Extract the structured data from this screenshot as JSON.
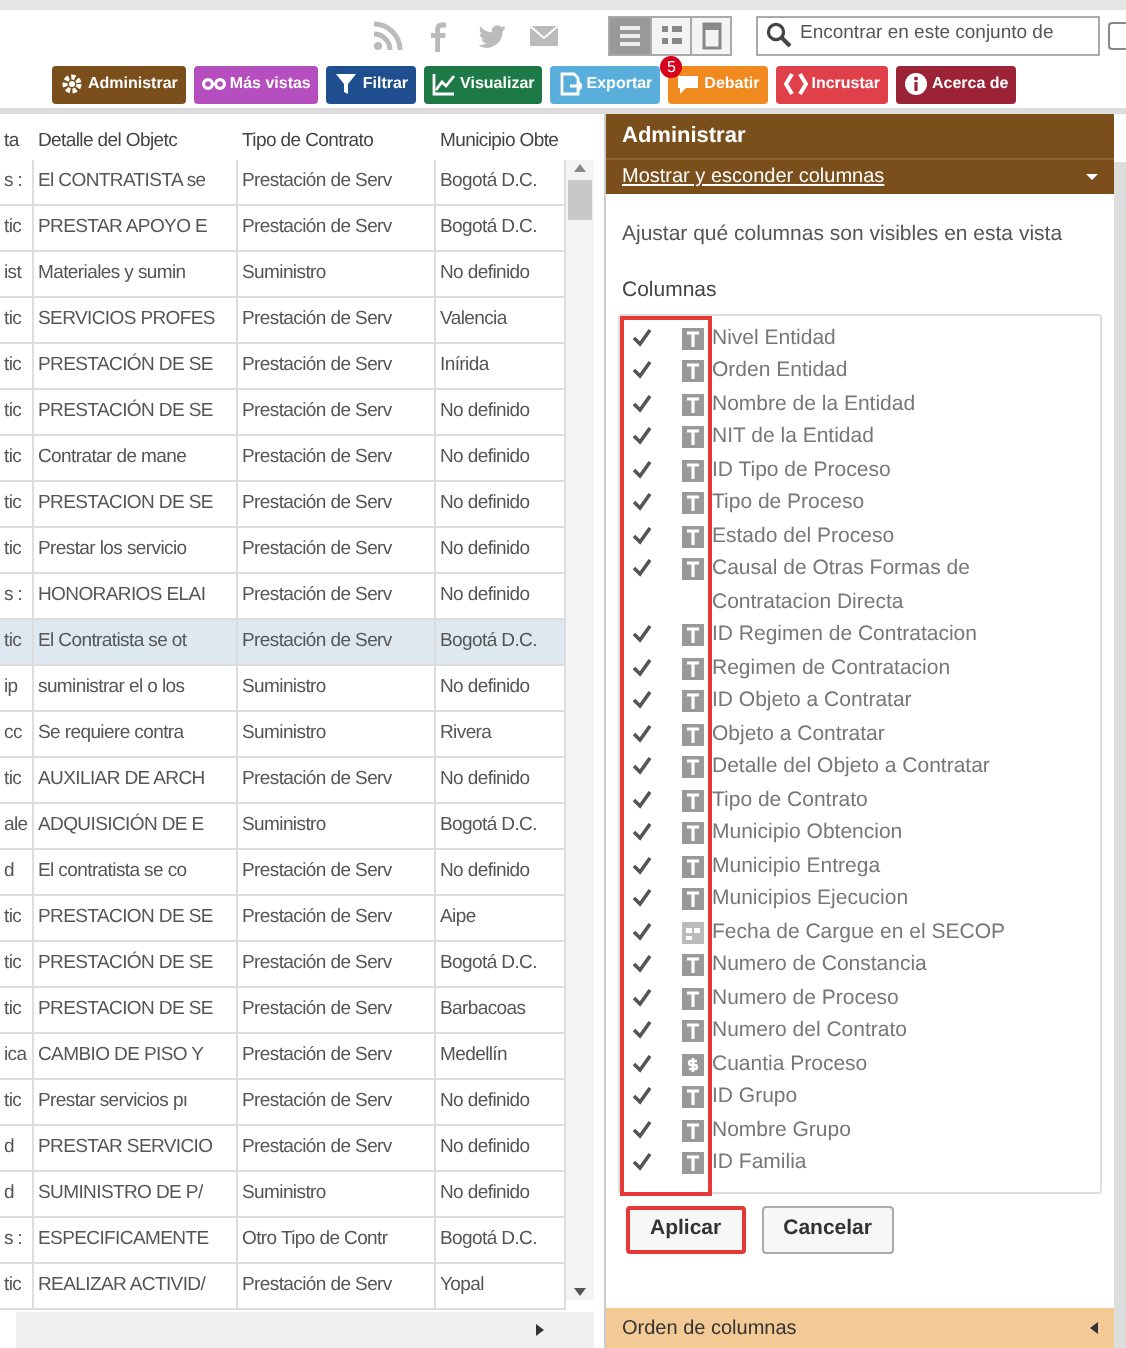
{
  "view_modes": [
    {
      "kind": "table",
      "selected": true
    },
    {
      "kind": "cards",
      "selected": false
    },
    {
      "kind": "single",
      "selected": false
    }
  ],
  "search": {
    "placeholder": "Encontrar en este conjunto de"
  },
  "toolbar": [
    {
      "label": "Administrar",
      "color": "#7a4f1c"
    },
    {
      "label": "Más vistas",
      "color": "#b54fbf"
    },
    {
      "label": "Filtrar",
      "color": "#1f4f8f"
    },
    {
      "label": "Visualizar",
      "color": "#1d7a46"
    },
    {
      "label": "Exportar",
      "color": "#5aaedc"
    },
    {
      "label": "Debatir",
      "color": "#f0891e",
      "badge": "5"
    },
    {
      "label": "Incrustar",
      "color": "#e0404a"
    },
    {
      "label": "Acerca de",
      "color": "#9b2335"
    }
  ],
  "table": {
    "columns": [
      "ta",
      "Detalle del Objetc",
      "Tipo de Contrato",
      "Municipio Obte"
    ],
    "rows": [
      {
        "cells": [
          "s :",
          "El CONTRATISTA se",
          "Prestación de Serv",
          "Bogotá D.C."
        ],
        "selected": false
      },
      {
        "cells": [
          "tic",
          "PRESTAR APOYO E",
          "Prestación de Serv",
          "Bogotá D.C."
        ],
        "selected": false
      },
      {
        "cells": [
          "ist",
          "Materiales y sumin",
          "Suministro",
          "No definido"
        ],
        "selected": false
      },
      {
        "cells": [
          "tic",
          "SERVICIOS PROFES",
          "Prestación de Serv",
          "Valencia"
        ],
        "selected": false
      },
      {
        "cells": [
          "tic",
          "PRESTACIÓN DE SE",
          "Prestación de Serv",
          "Inírida"
        ],
        "selected": false
      },
      {
        "cells": [
          "tic",
          "PRESTACIÓN DE SE",
          "Prestación de Serv",
          "No definido"
        ],
        "selected": false
      },
      {
        "cells": [
          "tic",
          "Contratar de mane",
          "Prestación de Serv",
          "No definido"
        ],
        "selected": false
      },
      {
        "cells": [
          "tic",
          "PRESTACION DE SE",
          "Prestación de Serv",
          "No definido"
        ],
        "selected": false
      },
      {
        "cells": [
          "tic",
          "Prestar los servicio",
          "Prestación de Serv",
          "No definido"
        ],
        "selected": false
      },
      {
        "cells": [
          "s :",
          "HONORARIOS ELAI",
          "Prestación de Serv",
          "No definido"
        ],
        "selected": false
      },
      {
        "cells": [
          "tic",
          "El Contratista se ot",
          "Prestación de Serv",
          "Bogotá D.C."
        ],
        "selected": true
      },
      {
        "cells": [
          "ip",
          "suministrar el o los",
          "Suministro",
          "No definido"
        ],
        "selected": false
      },
      {
        "cells": [
          "cc",
          "Se requiere contra",
          "Suministro",
          "Rivera"
        ],
        "selected": false
      },
      {
        "cells": [
          "tic",
          "AUXILIAR DE ARCH",
          "Prestación de Serv",
          "No definido"
        ],
        "selected": false
      },
      {
        "cells": [
          "ale",
          "ADQUISICIÓN DE E",
          "Suministro",
          "Bogotá D.C."
        ],
        "selected": false
      },
      {
        "cells": [
          "d",
          "El contratista se co",
          "Prestación de Serv",
          "No definido"
        ],
        "selected": false
      },
      {
        "cells": [
          "tic",
          "PRESTACION DE SE",
          "Prestación de Serv",
          "Aipe"
        ],
        "selected": false
      },
      {
        "cells": [
          "tic",
          "PRESTACIÓN DE SE",
          "Prestación de Serv",
          "Bogotá D.C."
        ],
        "selected": false
      },
      {
        "cells": [
          "tic",
          "PRESTACION DE SE",
          "Prestación de Serv",
          "Barbacoas"
        ],
        "selected": false
      },
      {
        "cells": [
          "ica",
          "CAMBIO DE PISO Y",
          "Prestación de Serv",
          "Medellín"
        ],
        "selected": false
      },
      {
        "cells": [
          "tic",
          "Prestar servicios pı",
          "Prestación de Serv",
          "No definido"
        ],
        "selected": false
      },
      {
        "cells": [
          "d",
          "PRESTAR SERVICIO",
          "Prestación de Serv",
          "No definido"
        ],
        "selected": false
      },
      {
        "cells": [
          "d",
          "SUMINISTRO DE P/",
          "Suministro",
          "No definido"
        ],
        "selected": false
      },
      {
        "cells": [
          "s :",
          "ESPECIFICAMENTE",
          "Otro Tipo de Contr",
          "Bogotá D.C."
        ],
        "selected": false
      },
      {
        "cells": [
          "tic",
          "REALIZAR ACTIVID/",
          "Prestación de Serv",
          "Yopal"
        ],
        "selected": false
      }
    ]
  },
  "panel": {
    "title": "Administrar",
    "section": "Mostrar y esconder columnas",
    "description": "Ajustar qué columnas son visibles en esta vista",
    "list_label": "Columnas",
    "columns": [
      {
        "label": "Nivel Entidad",
        "kind": "text",
        "checked": true
      },
      {
        "label": "Orden Entidad",
        "kind": "text",
        "checked": true
      },
      {
        "label": "Nombre de la Entidad",
        "kind": "text",
        "checked": true
      },
      {
        "label": "NIT de la Entidad",
        "kind": "text",
        "checked": true
      },
      {
        "label": "ID Tipo de Proceso",
        "kind": "text",
        "checked": true
      },
      {
        "label": "Tipo de Proceso",
        "kind": "text",
        "checked": true
      },
      {
        "label": "Estado del Proceso",
        "kind": "text",
        "checked": true
      },
      {
        "label": "Causal de Otras Formas de Contratacion Directa",
        "kind": "text",
        "checked": true
      },
      {
        "label": "ID Regimen de Contratacion",
        "kind": "text",
        "checked": true
      },
      {
        "label": "Regimen de Contratacion",
        "kind": "text",
        "checked": true
      },
      {
        "label": "ID Objeto a Contratar",
        "kind": "text",
        "checked": true
      },
      {
        "label": "Objeto a Contratar",
        "kind": "text",
        "checked": true
      },
      {
        "label": "Detalle del Objeto a Contratar",
        "kind": "text",
        "checked": true
      },
      {
        "label": "Tipo de Contrato",
        "kind": "text",
        "checked": true
      },
      {
        "label": "Municipio Obtencion",
        "kind": "text",
        "checked": true
      },
      {
        "label": "Municipio Entrega",
        "kind": "text",
        "checked": true
      },
      {
        "label": "Municipios Ejecucion",
        "kind": "text",
        "checked": true
      },
      {
        "label": "Fecha de Cargue en el SECOP",
        "kind": "date",
        "checked": true
      },
      {
        "label": "Numero de Constancia",
        "kind": "text",
        "checked": true
      },
      {
        "label": "Numero de Proceso",
        "kind": "text",
        "checked": true
      },
      {
        "label": "Numero del Contrato",
        "kind": "text",
        "checked": true
      },
      {
        "label": "Cuantia Proceso",
        "kind": "money",
        "checked": true
      },
      {
        "label": "ID Grupo",
        "kind": "text",
        "checked": true
      },
      {
        "label": "Nombre Grupo",
        "kind": "text",
        "checked": true
      },
      {
        "label": "ID Familia",
        "kind": "text",
        "checked": true
      }
    ],
    "buttons": [
      {
        "label": "Aplicar",
        "highlighted": true
      },
      {
        "label": "Cancelar",
        "highlighted": false
      }
    ],
    "next_section": "Orden de columnas"
  }
}
